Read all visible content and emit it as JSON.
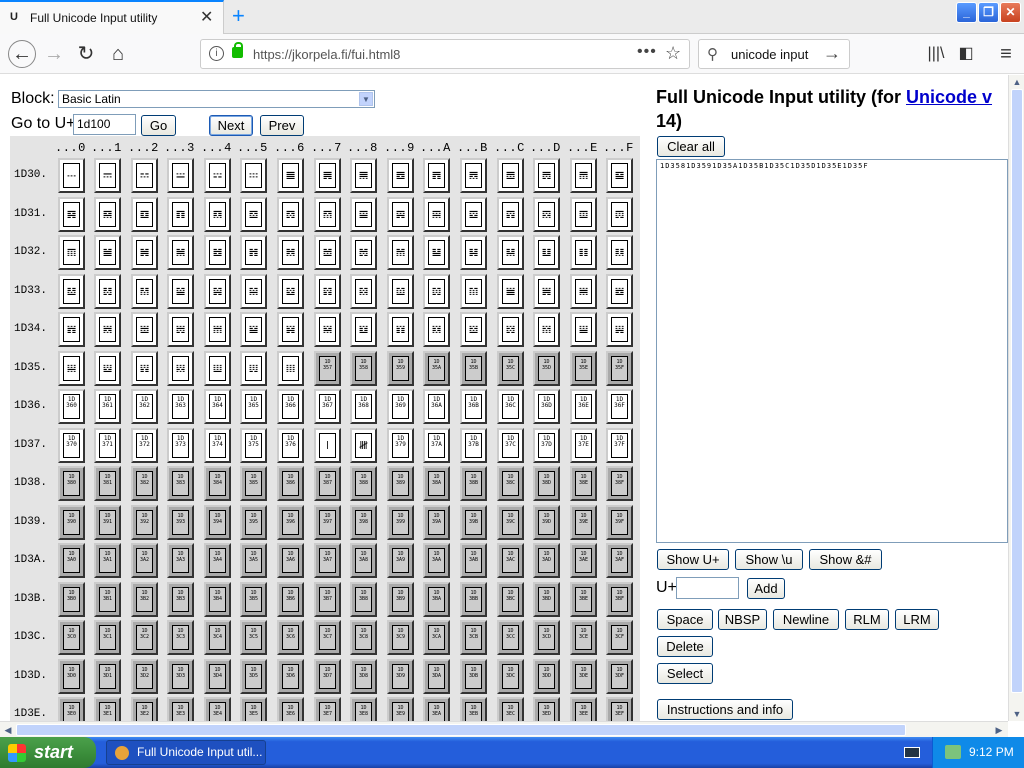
{
  "browser": {
    "tab_title": "Full Unicode Input utility",
    "tab_favicon": "U",
    "url": "https://jkorpela.fi/fui.html8",
    "search_text": "unicode input",
    "window_controls": [
      "_",
      "❐",
      "✕"
    ]
  },
  "page": {
    "block_label": "Block:",
    "block_value": "Basic Latin",
    "goto_label": "Go to U+",
    "goto_value": "1d100",
    "go_button": "Go",
    "next_button": "Next",
    "prev_button": "Prev",
    "col_headers": [
      "...0",
      "...1",
      "...2",
      "...3",
      "...4",
      "...5",
      "...6",
      "...7",
      "...8",
      "...9",
      "...A",
      "...B",
      "...C",
      "...D",
      "...E",
      "...F"
    ],
    "row_headers": [
      "1D30.",
      "1D31.",
      "1D32.",
      "1D33.",
      "1D34.",
      "1D35.",
      "1D36.",
      "1D37.",
      "1D38.",
      "1D39.",
      "1D3A.",
      "1D3B.",
      "1D3C.",
      "1D3D.",
      "1D3E."
    ],
    "row_codes": [
      "1D30",
      "1D31",
      "1D32",
      "1D33",
      "1D34",
      "1D35",
      "1D36",
      "1D37",
      "1D38",
      "1D39",
      "1D3A",
      "1D3B",
      "1D3C",
      "1D3D",
      "1D3E"
    ],
    "hex_digits": [
      "0",
      "1",
      "2",
      "3",
      "4",
      "5",
      "6",
      "7",
      "8",
      "9",
      "A",
      "B",
      "C",
      "D",
      "E",
      "F"
    ],
    "glyphs": {
      "1D30": [
        "𝌀",
        "𝌁",
        "𝌂",
        "𝌃",
        "𝌄",
        "𝌅",
        "𝌆",
        "𝌇",
        "𝌈",
        "𝌉",
        "𝌊",
        "𝌋",
        "𝌌",
        "𝌍",
        "𝌎",
        "𝌏"
      ],
      "1D31": [
        "𝌐",
        "𝌑",
        "𝌒",
        "𝌓",
        "𝌔",
        "𝌕",
        "𝌖",
        "𝌗",
        "𝌘",
        "𝌙",
        "𝌚",
        "𝌛",
        "𝌜",
        "𝌝",
        "𝌞",
        "𝌟"
      ],
      "1D32": [
        "𝌠",
        "𝌡",
        "𝌢",
        "𝌣",
        "𝌤",
        "𝌥",
        "𝌦",
        "𝌧",
        "𝌨",
        "𝌩",
        "𝌪",
        "𝌫",
        "𝌬",
        "𝌭",
        "𝌮",
        "𝌯"
      ],
      "1D33": [
        "𝌰",
        "𝌱",
        "𝌲",
        "𝌳",
        "𝌴",
        "𝌵",
        "𝌶",
        "𝌷",
        "𝌸",
        "𝌹",
        "𝌺",
        "𝌻",
        "𝌼",
        "𝌽",
        "𝌾",
        "𝌿"
      ],
      "1D34": [
        "𝍀",
        "𝍁",
        "𝍂",
        "𝍃",
        "𝍄",
        "𝍅",
        "𝍆",
        "𝍇",
        "𝍈",
        "𝍉",
        "𝍊",
        "𝍋",
        "𝍌",
        "𝍍",
        "𝍎",
        "𝍏"
      ],
      "1D35": [
        "𝍐",
        "𝍑",
        "𝍒",
        "𝍓",
        "𝍔",
        "𝍕",
        "𝍖"
      ],
      "1D37": [
        "",
        "",
        "",
        "",
        "",
        "",
        "",
        "𝍷",
        "𝍸"
      ]
    },
    "right_title": "Full Unicode Input utility (for ",
    "right_title_link": "Unicode v",
    "right_title_line2": "14)",
    "clear_all_button": "Clear all",
    "textarea_content": "1D3581D3591D35A1D35B1D35C1D35D1D35E1D35F",
    "show_uplus_button": "Show U+",
    "show_u_button": "Show \\u",
    "show_amp_button": "Show &#",
    "uplus_label": "U+",
    "add_button": "Add",
    "space_button": "Space",
    "nbsp_button": "NBSP",
    "newline_button": "Newline",
    "rlm_button": "RLM",
    "lrm_button": "LRM",
    "delete_button": "Delete",
    "select_button": "Select",
    "instructions_button": "Instructions and info"
  },
  "taskbar": {
    "start_label": "start",
    "task_item": "Full Unicode Input util...",
    "clock": "9:12 PM"
  }
}
